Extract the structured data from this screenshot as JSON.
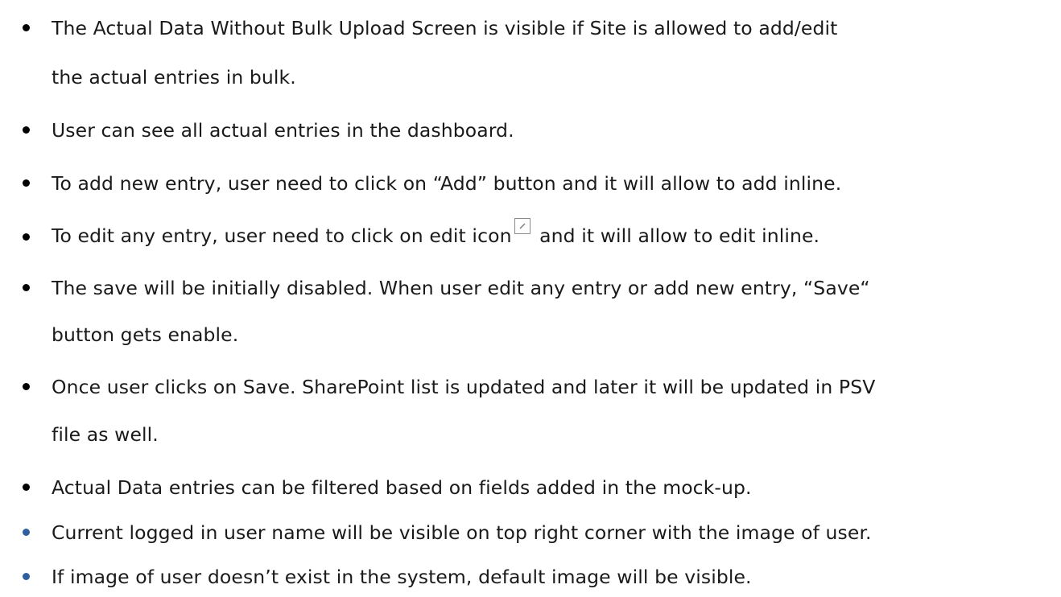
{
  "bullets": [
    {
      "lines": [
        "The Actual Data Without Bulk Upload Screen is visible if Site is allowed to add/edit",
        "the actual entries in bulk."
      ]
    },
    {
      "lines": [
        "User can see all actual entries in the dashboard."
      ]
    },
    {
      "lines": [
        "To add new entry, user need to click on “Add” button and it will allow to add inline."
      ]
    },
    {
      "lines": [
        "To edit any entry, user need to click on edit icon"
      ],
      "after_icon": " and it will allow to edit inline.",
      "icon": "edit-pencil-icon"
    },
    {
      "lines": [
        "The save will be initially disabled. When user edit any entry or add new entry, “Save“",
        "button gets enable."
      ]
    },
    {
      "lines": [
        "Once user clicks on Save. SharePoint list is updated and later it will be updated in PSV",
        "file as well."
      ]
    },
    {
      "lines": [
        "Actual Data entries can be filtered based on fields added in the mock-up."
      ]
    },
    {
      "lines": [
        "Current logged in user name will be visible on top right corner with the image of user."
      ]
    },
    {
      "lines": [
        "If image of user doesn’t exist in the system, default image will be visible."
      ]
    }
  ],
  "colors": {
    "text": "#1a1a1a",
    "bullet": "#000000",
    "bullet_accent": "#2f5f9e"
  }
}
